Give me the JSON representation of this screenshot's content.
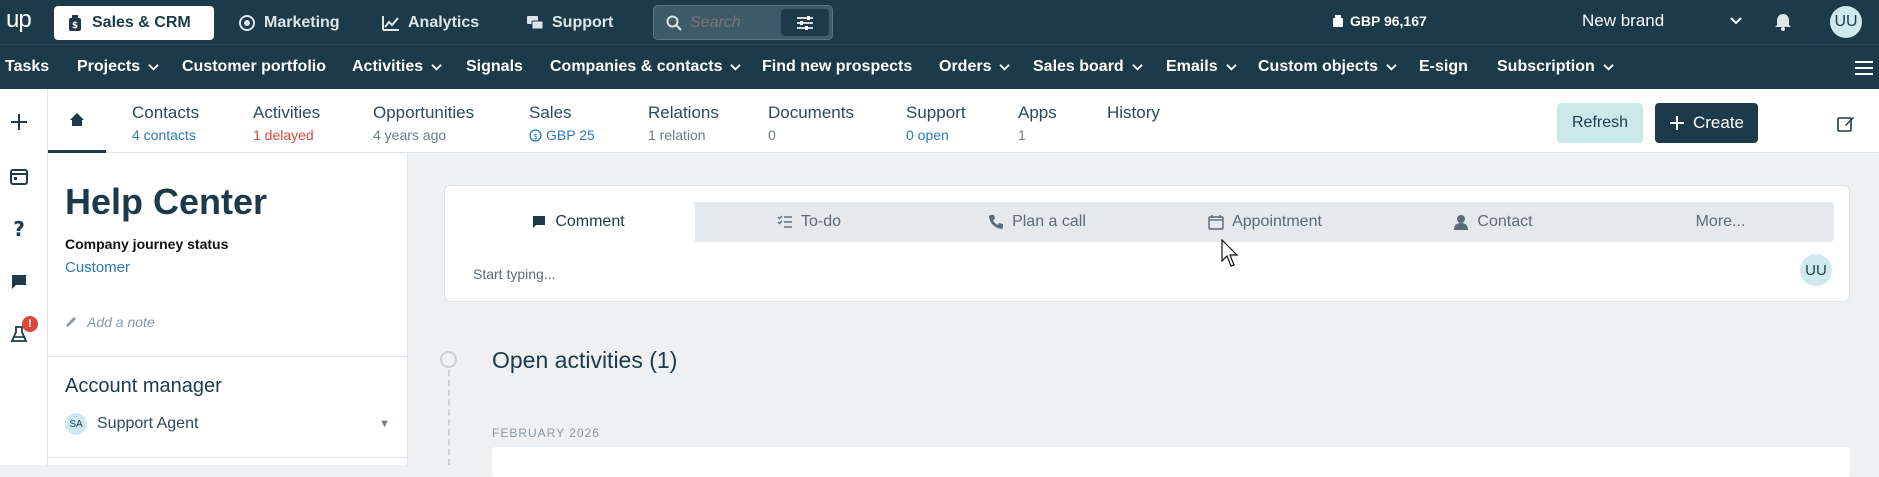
{
  "topbar": {
    "logo": "up",
    "nav": [
      {
        "label": "Sales & CRM",
        "icon": "dollar-bag-icon",
        "active": true
      },
      {
        "label": "Marketing",
        "icon": "target-icon"
      },
      {
        "label": "Analytics",
        "icon": "chart-line-icon"
      },
      {
        "label": "Support",
        "icon": "chat-bubbles-icon"
      }
    ],
    "search_placeholder": "Search",
    "balance": "GBP 96,167",
    "brand": "New brand",
    "avatar": "UU"
  },
  "menubar": {
    "items": [
      {
        "label": "Tasks",
        "dropdown": false
      },
      {
        "label": "Projects",
        "dropdown": true
      },
      {
        "label": "Customer portfolio",
        "dropdown": false
      },
      {
        "label": "Activities",
        "dropdown": true
      },
      {
        "label": "Signals",
        "dropdown": false
      },
      {
        "label": "Companies & contacts",
        "dropdown": true
      },
      {
        "label": "Find new prospects",
        "dropdown": false
      },
      {
        "label": "Orders",
        "dropdown": true
      },
      {
        "label": "Sales board",
        "dropdown": true
      },
      {
        "label": "Emails",
        "dropdown": true
      },
      {
        "label": "Custom objects",
        "dropdown": true
      },
      {
        "label": "E-sign",
        "dropdown": false
      },
      {
        "label": "Subscription",
        "dropdown": true
      }
    ]
  },
  "rail": {
    "badge": "!"
  },
  "subnav": {
    "tabs": [
      {
        "label": "Contacts",
        "sub": "4 contacts",
        "tone": "blue"
      },
      {
        "label": "Activities",
        "sub": "1 delayed",
        "tone": "red"
      },
      {
        "label": "Opportunities",
        "sub": "4 years ago",
        "tone": "gray"
      },
      {
        "label": "Sales",
        "sub": "GBP 25",
        "tone": "blue"
      },
      {
        "label": "Relations",
        "sub": "1 relation",
        "tone": "gray"
      },
      {
        "label": "Documents",
        "sub": "0",
        "tone": "gray"
      },
      {
        "label": "Support",
        "sub": "0 open",
        "tone": "blue"
      },
      {
        "label": "Apps",
        "sub": "1",
        "tone": "gray"
      },
      {
        "label": "History",
        "sub": "",
        "tone": "gray"
      }
    ],
    "refresh_label": "Refresh",
    "create_label": "Create"
  },
  "company": {
    "name": "Help Center",
    "journey_label": "Company journey status",
    "journey_value": "Customer",
    "note_placeholder": "Add a note",
    "account_manager_title": "Account manager",
    "account_manager_initials": "SA",
    "account_manager_name": "Support Agent"
  },
  "composer": {
    "tabs": [
      {
        "label": "Comment",
        "icon": "comment-icon",
        "active": true
      },
      {
        "label": "To-do",
        "icon": "checklist-icon"
      },
      {
        "label": "Plan a call",
        "icon": "phone-icon"
      },
      {
        "label": "Appointment",
        "icon": "calendar-icon"
      },
      {
        "label": "Contact",
        "icon": "person-icon"
      },
      {
        "label": "More...",
        "icon": ""
      }
    ],
    "placeholder": "Start typing...",
    "avatar": "UU"
  },
  "timeline": {
    "heading": "Open activities (1)",
    "month": "FEBRUARY 2026"
  },
  "colors": {
    "primary": "#1d3a4a",
    "accent_blue": "#2a7ab8",
    "danger": "#d9483b",
    "refresh_bg": "#cce9ea"
  }
}
